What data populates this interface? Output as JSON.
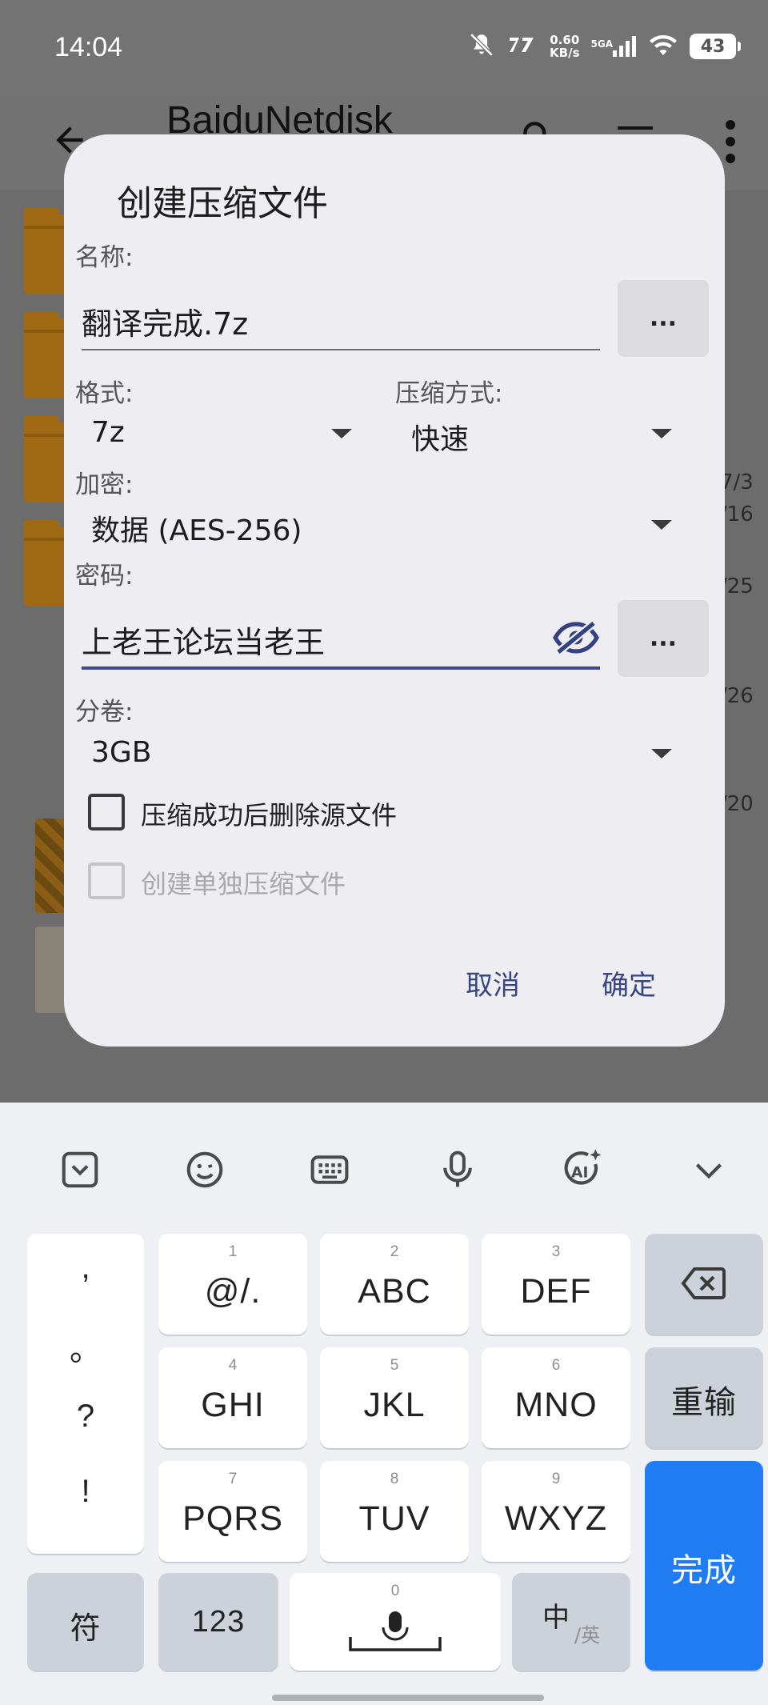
{
  "status_bar": {
    "time": "14:04",
    "speed_value": "0.60",
    "speed_unit": "KB/s",
    "network": "5GA",
    "battery": "43"
  },
  "app": {
    "title": "BaiduNetdisk",
    "bg_dates": [
      "/16",
      "7/3",
      "/25",
      "/26",
      "/20"
    ]
  },
  "dialog": {
    "title": "创建压缩文件",
    "name_label": "名称:",
    "name_value": "翻译完成.7z",
    "browse_button": "...",
    "format_label": "格式:",
    "format_value": "7z",
    "method_label": "压缩方式:",
    "method_value": "快速",
    "encryption_label": "加密:",
    "encryption_value": "数据 (AES-256)",
    "password_label": "密码:",
    "password_value": "上老王论坛当老王",
    "password_button": "...",
    "split_label": "分卷:",
    "split_value": "3GB",
    "delete_source_label": "压缩成功后删除源文件",
    "delete_source_checked": false,
    "separate_archives_label": "创建单独压缩文件",
    "separate_archives_enabled": false,
    "cancel_label": "取消",
    "ok_label": "确定"
  },
  "keyboard": {
    "punct": [
      ",",
      "。",
      "?",
      "!"
    ],
    "keys": [
      {
        "num": "1",
        "label": "@/."
      },
      {
        "num": "2",
        "label": "ABC"
      },
      {
        "num": "3",
        "label": "DEF"
      },
      {
        "num": "4",
        "label": "GHI"
      },
      {
        "num": "5",
        "label": "JKL"
      },
      {
        "num": "6",
        "label": "MNO"
      },
      {
        "num": "7",
        "label": "PQRS"
      },
      {
        "num": "8",
        "label": "TUV"
      },
      {
        "num": "9",
        "label": "WXYZ"
      }
    ],
    "retype_label": "重输",
    "done_label": "完成",
    "symbols_label": "符",
    "numbers_label": "123",
    "space_num": "0",
    "lang_main": "中",
    "lang_alt": "/英",
    "accent_color": "#1f7cf3"
  }
}
